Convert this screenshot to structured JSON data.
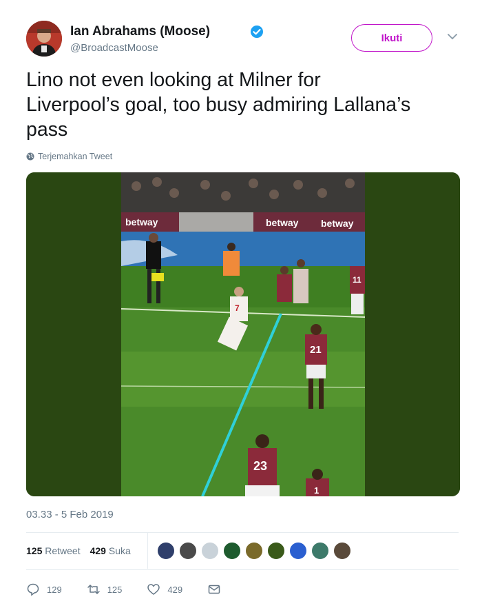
{
  "author": {
    "display_name": "Ian Abrahams (Moose)",
    "handle": "@BroadcastMoose",
    "verified": true
  },
  "follow_button": {
    "label": "Ikuti"
  },
  "tweet": {
    "text_line1": "Lino not even looking at Milner for",
    "text_line2": "Liverpool’s goal, too busy admiring Lallana’s",
    "text_line3": "pass",
    "translate_label": "Terjemahkan Tweet",
    "timestamp": "03.33 - 5 Feb 2019"
  },
  "media": {
    "board_1": "betway",
    "board_2": "betway",
    "board_3": "betway",
    "shirt_1": "7",
    "shirt_2": "21",
    "shirt_3": "23",
    "shirt_4": "11",
    "shirt_5": "1",
    "icon": "video-still"
  },
  "stats": {
    "retweets_count": "125",
    "retweets_label": "Retweet",
    "likes_count": "429",
    "likes_label": "Suka"
  },
  "likers": [
    {
      "color": "#2f3f6b"
    },
    {
      "color": "#4a4a4a"
    },
    {
      "color": "#c9d2d9"
    },
    {
      "color": "#1e5b2e"
    },
    {
      "color": "#7a6a2a"
    },
    {
      "color": "#3a5a1a"
    },
    {
      "color": "#2a5fd0"
    },
    {
      "color": "#3d7a6a"
    },
    {
      "color": "#5a4a3a"
    }
  ],
  "actions": {
    "reply_count": "129",
    "retweet_count": "125",
    "like_count": "429"
  },
  "colors": {
    "brand_follow": "#c014c9",
    "verified_blue": "#1da1f2",
    "muted_text": "#657786"
  }
}
